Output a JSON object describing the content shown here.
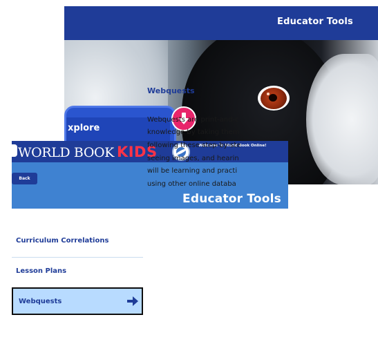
{
  "back_window": {
    "header_title": "Educator Tools"
  },
  "explore_card": {
    "label": "xplore"
  },
  "front_window": {
    "logo": {
      "world_book": "WORLD BOOK",
      "kids": "KIDS"
    },
    "welcome_text": "Welcome To World Book Online!",
    "back_button_label": "Back",
    "banner_title": "Educator Tools",
    "sidebar": {
      "items": [
        {
          "label": "Curriculum Correlations",
          "selected": false
        },
        {
          "label": "Lesson Plans",
          "selected": false
        },
        {
          "label": "Webquests",
          "selected": true
        }
      ]
    },
    "main": {
      "title": "Webquests",
      "lines": [
        "Webquests are print-and-c",
        "knowledge by taking them",
        "following these step-by-ste",
        "seeing images, and hearin",
        "will be learning and practi",
        "using other online databa"
      ]
    }
  },
  "colors": {
    "header_navy": "#1f3c98",
    "banner_blue": "#3f82d1",
    "selected_bg": "#b8dbff",
    "kids_red": "#ff3347",
    "badge_pink": "#e8256b"
  }
}
